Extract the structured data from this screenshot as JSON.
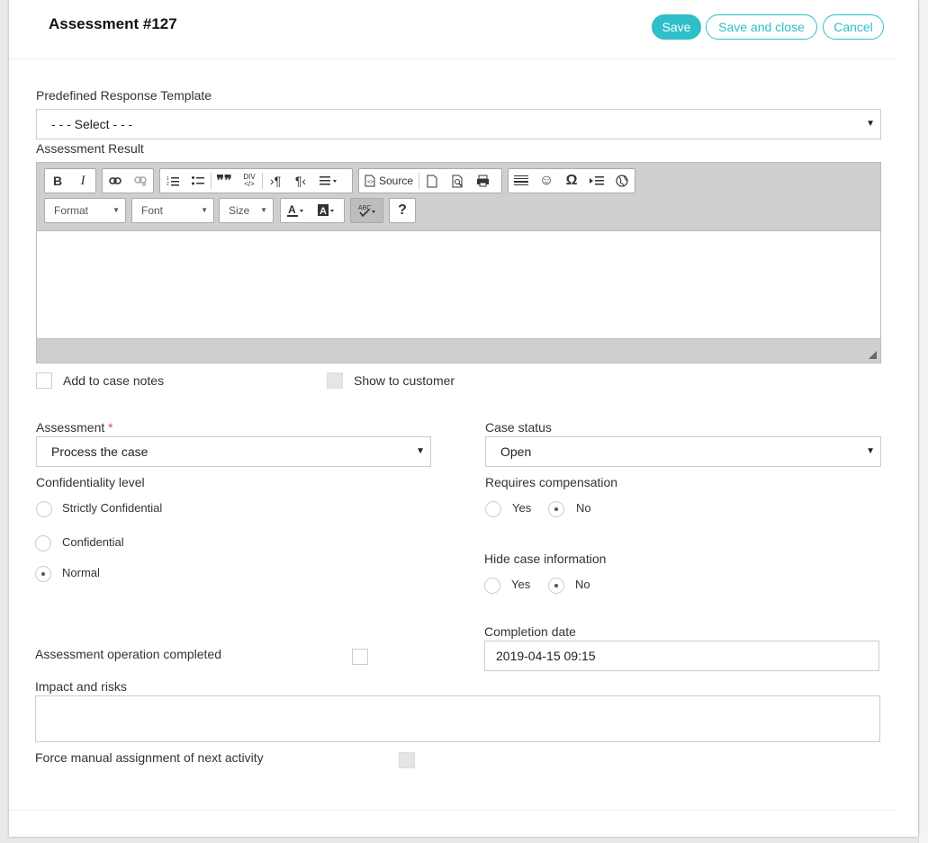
{
  "header": {
    "title": "Assessment #127",
    "save_label": "Save",
    "save_close_label": "Save and close",
    "cancel_label": "Cancel"
  },
  "template": {
    "label": "Predefined Response Template",
    "value": "- - - Select - - -"
  },
  "editor": {
    "label": "Assessment Result",
    "source_label": "Source",
    "format_label": "Format",
    "font_label": "Font",
    "size_label": "Size"
  },
  "add_to_case_notes": {
    "label": "Add to case notes",
    "checked": false
  },
  "show_to_customer": {
    "label": "Show to customer",
    "checked": false
  },
  "assessment": {
    "label": "Assessment",
    "required": "*",
    "value": "Process the case"
  },
  "case_status": {
    "label": "Case status",
    "value": "Open"
  },
  "confidentiality": {
    "label": "Confidentiality level",
    "options": [
      "Strictly Confidential",
      "Confidential",
      "Normal"
    ],
    "selected": "Normal"
  },
  "requires_compensation": {
    "label": "Requires compensation",
    "yes": "Yes",
    "no": "No",
    "selected": "No"
  },
  "hide_case_information": {
    "label": "Hide case information",
    "yes": "Yes",
    "no": "No",
    "selected": "No"
  },
  "completion_date": {
    "label": "Completion date",
    "value": "2019-04-15 09:15"
  },
  "assessment_operation_completed": {
    "label": "Assessment operation completed",
    "checked": false
  },
  "impact_and_risks": {
    "label": "Impact and risks",
    "value": ""
  },
  "force_manual_assignment": {
    "label": "Force manual assignment of next activity",
    "checked": false
  }
}
